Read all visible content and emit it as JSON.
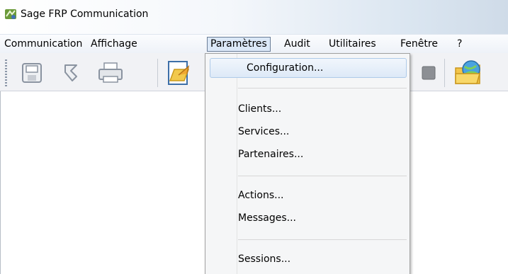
{
  "window": {
    "title": "Sage FRP Communication",
    "icon": "sage-app-icon"
  },
  "menubar": {
    "items": [
      {
        "label": "Communication",
        "active": false
      },
      {
        "label": "Affichage",
        "active": false
      },
      {
        "label": "Paramètres",
        "active": true
      },
      {
        "label": "Audit",
        "active": false
      },
      {
        "label": "Utilitaires",
        "active": false
      },
      {
        "label": "Fenêtre",
        "active": false
      },
      {
        "label": "?",
        "active": false
      }
    ]
  },
  "toolbar": {
    "buttons": [
      "save-icon",
      "undo-icon",
      "print-icon",
      "open-document-icon",
      "stop-icon",
      "network-folder-icon"
    ]
  },
  "dropdown": {
    "items": [
      {
        "label": "Configuration...",
        "highlighted": true
      },
      {
        "label": "Clients..."
      },
      {
        "label": "Services..."
      },
      {
        "label": "Partenaires..."
      },
      {
        "label": "Actions..."
      },
      {
        "label": "Messages..."
      },
      {
        "label": "Sessions..."
      }
    ]
  },
  "colors": {
    "menu_active_bg": "#dbe8f7",
    "menu_active_border": "#6b7e97",
    "highlight_border": "#aecae9",
    "menu_bg": "#f5f6f7"
  }
}
